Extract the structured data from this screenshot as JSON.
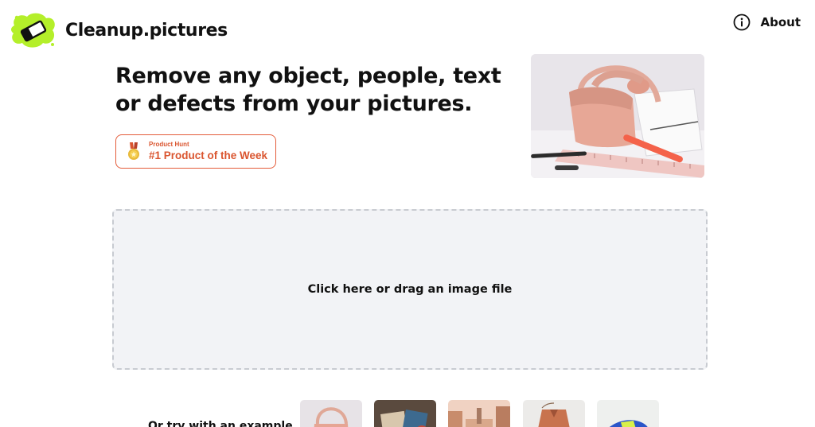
{
  "header": {
    "brand": "Cleanup.pictures",
    "about_label": "About"
  },
  "hero": {
    "headline": "Remove any object, people, text or defects from your pictures.",
    "badge": {
      "kicker": "Product Hunt",
      "title": "#1 Product of the Week"
    }
  },
  "dropzone": {
    "label": "Click here or drag an image file"
  },
  "samples": {
    "label": "Or try with an example",
    "thumbnails": [
      "sample-bag",
      "sample-desk",
      "sample-city",
      "sample-jacket",
      "sample-sneaker"
    ]
  },
  "colors": {
    "brand_green": "#b4ef2a",
    "product_hunt": "#da552f",
    "dropzone_bg": "#f2f3f6",
    "dropzone_border": "#c8cbd1"
  }
}
